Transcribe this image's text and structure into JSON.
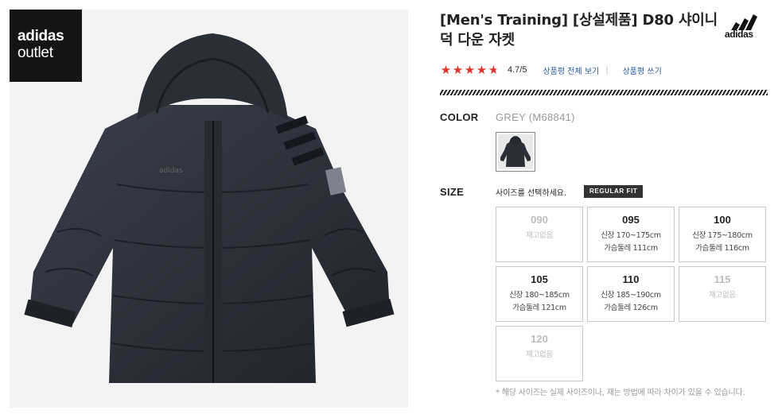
{
  "outlet_logo": {
    "line1": "adidas",
    "line2": "outlet"
  },
  "product": {
    "title": "[Men's Training] [상설제품] D80 샤이니 덕 다운 자켓",
    "brand_logo_text": "adidas"
  },
  "rating": {
    "stars": 4.7,
    "value_text": "4.7/5",
    "view_all_reviews": "상품평 전체 보기",
    "separator": "|",
    "write_review": "상품평 쓰기"
  },
  "color_option": {
    "label": "COLOR",
    "value": "GREY (M68841)"
  },
  "size_option": {
    "label": "SIZE",
    "hint": "사이즈를 선택하세요.",
    "fit_badge": "REGULAR FIT",
    "sizes": [
      {
        "size": "090",
        "line1": "재고없음",
        "line2": "",
        "available": false
      },
      {
        "size": "095",
        "line1": "신장 170~175cm",
        "line2": "가슴둘레 111cm",
        "available": true
      },
      {
        "size": "100",
        "line1": "신장 175~180cm",
        "line2": "가슴둘레 116cm",
        "available": true
      },
      {
        "size": "105",
        "line1": "신장 180~185cm",
        "line2": "가슴둘레 121cm",
        "available": true
      },
      {
        "size": "110",
        "line1": "신장 185~190cm",
        "line2": "가슴둘레 126cm",
        "available": true
      },
      {
        "size": "115",
        "line1": "재고없음",
        "line2": "",
        "available": false
      },
      {
        "size": "120",
        "line1": "재고없음",
        "line2": "",
        "available": false
      }
    ],
    "note": "* 해당 사이즈는 실제 사이즈이나, 재는 방법에 따라 차이가 있을 수 있습니다."
  },
  "colors": {
    "star": "#e0342b",
    "link": "#2d5aa3",
    "badge": "#333333",
    "jacket": "#2b2f38"
  }
}
